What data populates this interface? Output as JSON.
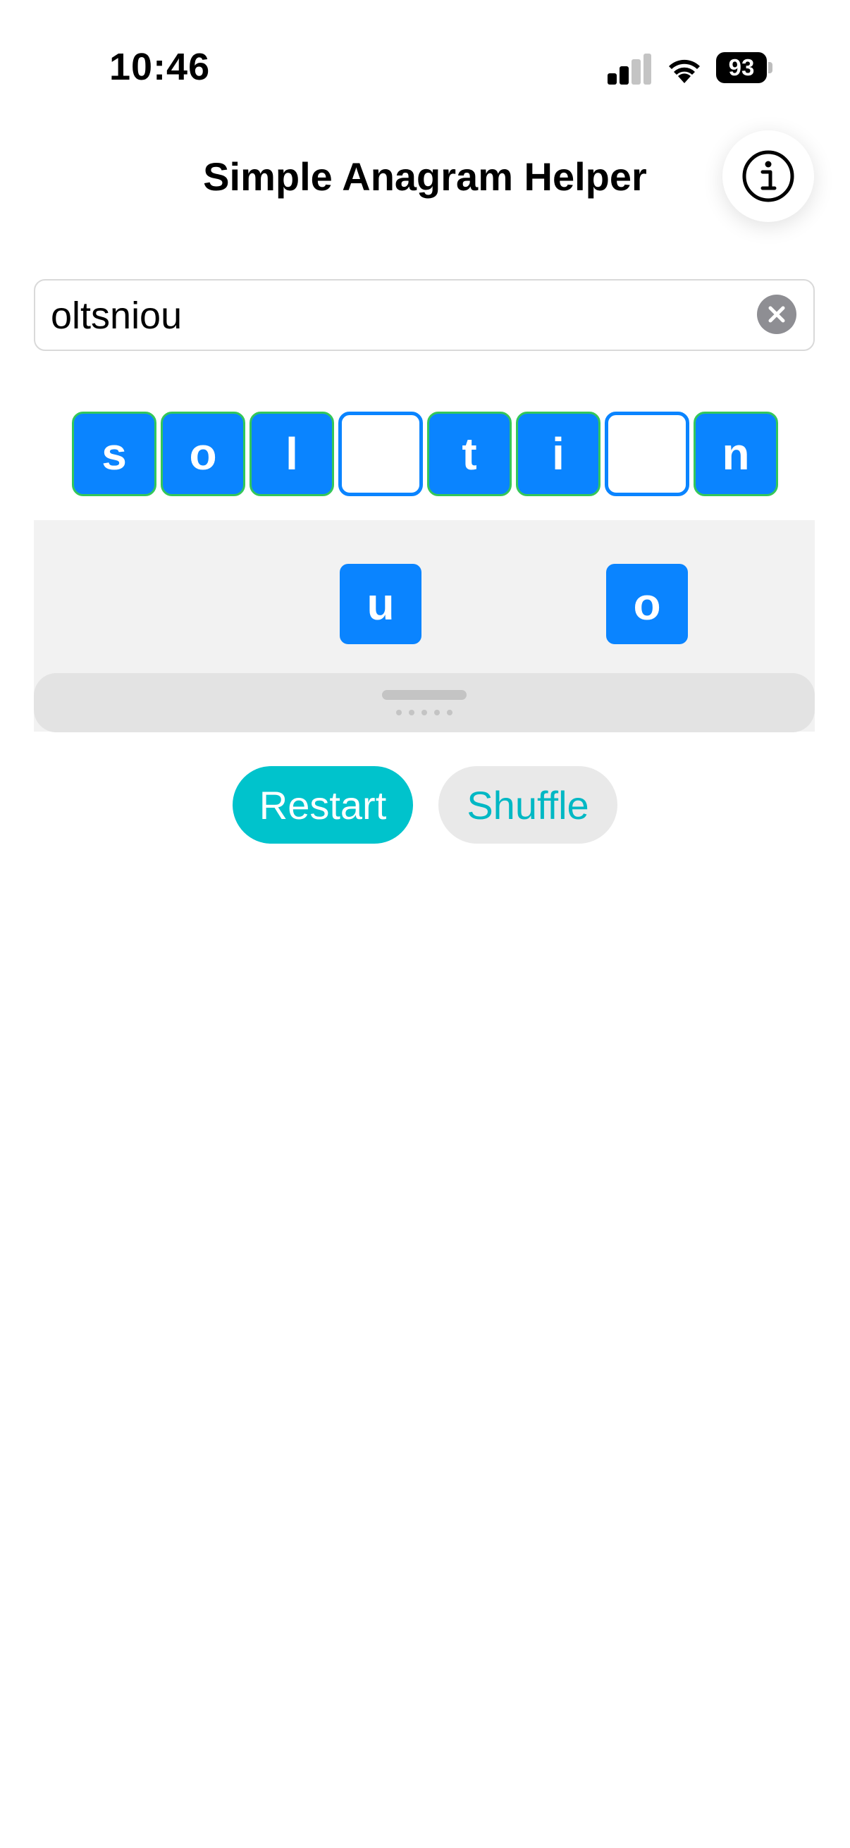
{
  "status_bar": {
    "time": "10:46",
    "battery": "93",
    "signal_icon": "cellular-signal-icon",
    "wifi_icon": "wifi-icon"
  },
  "header": {
    "title": "Simple Anagram Helper",
    "info_icon": "info-icon"
  },
  "input": {
    "value": "oltsniou",
    "clear_icon": "clear-icon"
  },
  "answer_slots": [
    {
      "letter": "s",
      "filled": true
    },
    {
      "letter": "o",
      "filled": true
    },
    {
      "letter": "l",
      "filled": true
    },
    {
      "letter": "",
      "filled": false
    },
    {
      "letter": "t",
      "filled": true
    },
    {
      "letter": "i",
      "filled": true
    },
    {
      "letter": "",
      "filled": false
    },
    {
      "letter": "n",
      "filled": true
    }
  ],
  "tray_tiles": [
    {
      "letter": "u",
      "slot": 3
    },
    {
      "letter": "o",
      "slot": 6
    }
  ],
  "buttons": {
    "restart": "Restart",
    "shuffle": "Shuffle"
  },
  "colors": {
    "tile_blue": "#0a84ff",
    "tile_border_green": "#34c759",
    "accent_teal": "#00c3cc"
  }
}
